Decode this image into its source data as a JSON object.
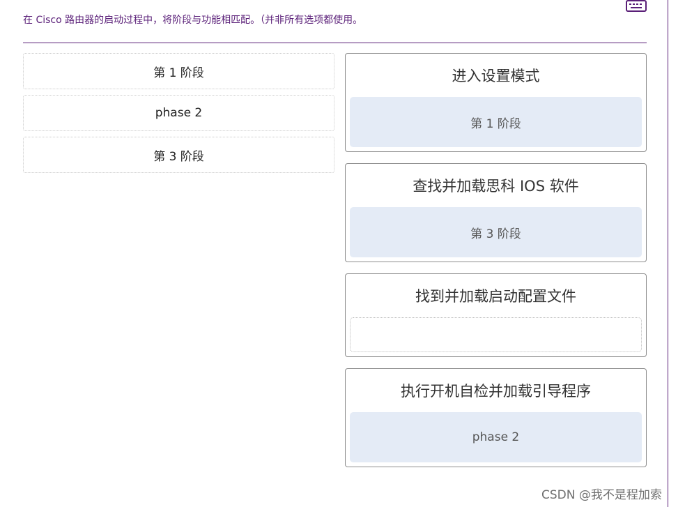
{
  "instruction": "在 Cisco 路由器的启动过程中，将阶段与功能相匹配。（并非所有选项都使用。",
  "icons": {
    "keyboard": "keyboard-icon"
  },
  "colors": {
    "accent": "#5a1f78",
    "drop_zone_bg": "#e4ebf6",
    "text": "#333333"
  },
  "options": [
    {
      "label": "第 1 阶段"
    },
    {
      "label": "phase 2"
    },
    {
      "label": "第 3 阶段"
    }
  ],
  "targets": [
    {
      "title": "进入设置模式",
      "answer": "第 1 阶段"
    },
    {
      "title": "查找并加载思科 IOS 软件",
      "answer": "第 3 阶段"
    },
    {
      "title": "找到并加载启动配置文件",
      "answer": ""
    },
    {
      "title": "执行开机自检并加载引导程序",
      "answer": "phase 2"
    }
  ],
  "watermark": "CSDN @我不是程加索"
}
